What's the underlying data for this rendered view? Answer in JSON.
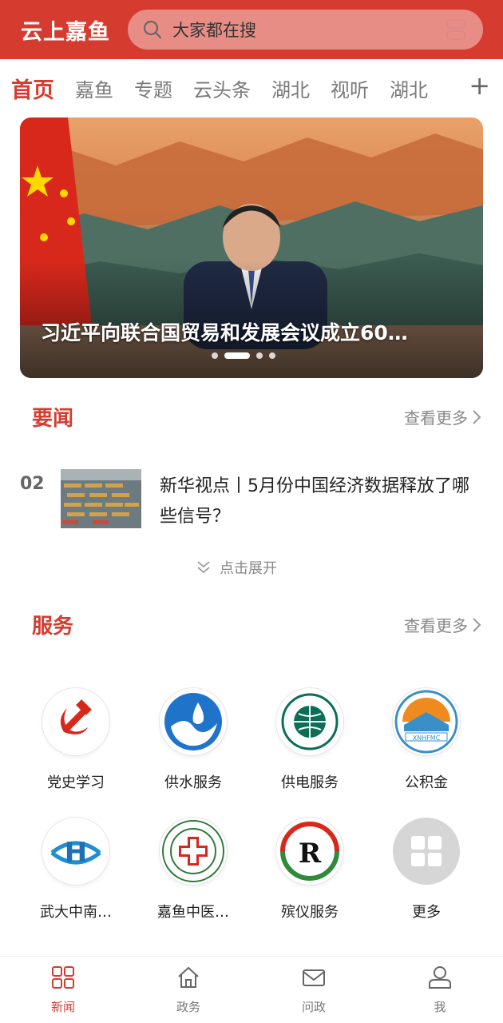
{
  "header": {
    "app_title": "云上嘉鱼",
    "search_placeholder": "大家都在搜"
  },
  "tabs": [
    {
      "label": "首页",
      "active": true
    },
    {
      "label": "嘉鱼"
    },
    {
      "label": "专题"
    },
    {
      "label": "云头条"
    },
    {
      "label": "湖北"
    },
    {
      "label": "视听"
    },
    {
      "label": "湖北"
    }
  ],
  "tabs_more": "+",
  "banner": {
    "caption": "习近平向联合国贸易和发展会议成立60…",
    "dots": 4,
    "active_dot": 1
  },
  "headlines": {
    "title": "要闻",
    "more": "查看更多",
    "items": [
      {
        "number": "02",
        "title": "新华视点丨5月份中国经济数据释放了哪些信号？"
      }
    ],
    "expand": "点击展开"
  },
  "services": {
    "title": "服务",
    "more": "查看更多",
    "items": [
      {
        "label": "党史学习",
        "icon": "hammer-sickle-icon"
      },
      {
        "label": "供水服务",
        "icon": "water-drop-icon"
      },
      {
        "label": "供电服务",
        "icon": "state-grid-icon"
      },
      {
        "label": "公积金",
        "icon": "housing-fund-icon"
      },
      {
        "label": "武大中南…",
        "icon": "hospital-h-icon"
      },
      {
        "label": "嘉鱼中医…",
        "icon": "tcm-hospital-icon"
      },
      {
        "label": "殡仪服务",
        "icon": "funeral-service-icon"
      },
      {
        "label": "更多",
        "icon": "grid-more-icon"
      }
    ]
  },
  "bottom_nav": [
    {
      "label": "新闻",
      "icon": "news-grid-icon",
      "active": true
    },
    {
      "label": "政务",
      "icon": "home-icon"
    },
    {
      "label": "问政",
      "icon": "mail-icon"
    },
    {
      "label": "我",
      "icon": "user-icon"
    }
  ],
  "colors": {
    "accent": "#d63b2f",
    "text_muted": "#888888"
  }
}
